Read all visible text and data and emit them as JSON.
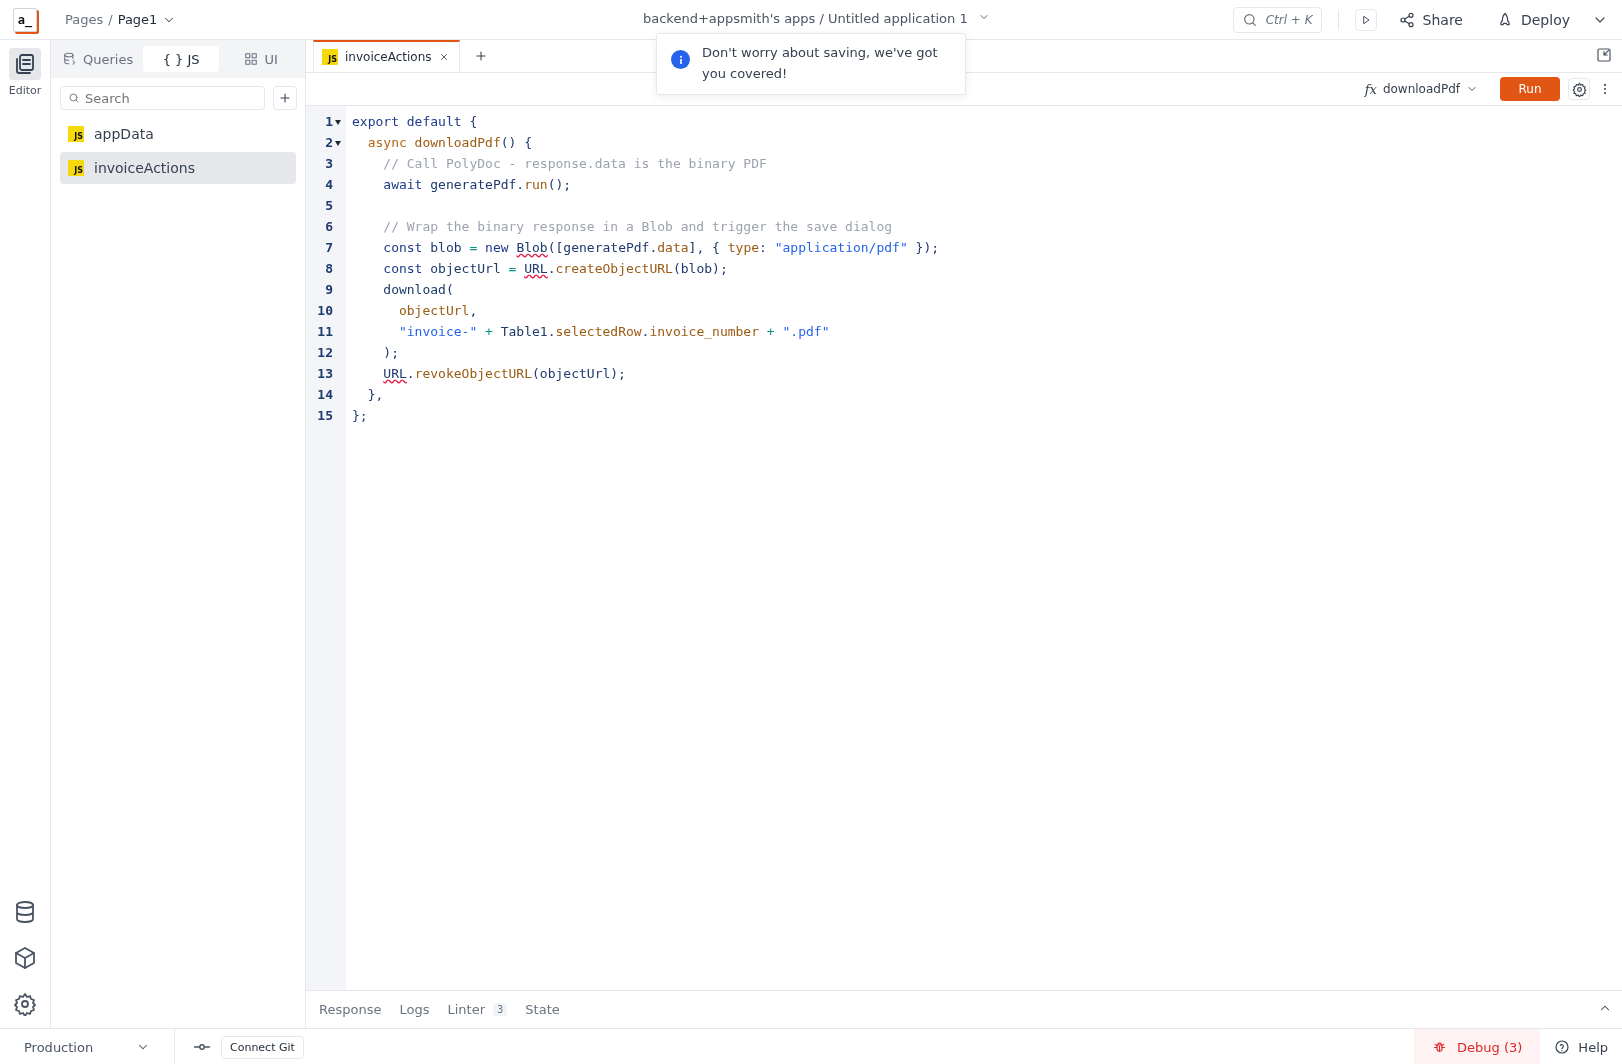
{
  "topbar": {
    "logo": "a_",
    "breadcrumb_root": "Pages",
    "breadcrumb_separator": "/",
    "breadcrumb_page": "Page1",
    "app_title": "backend+appsmith's apps / Untitled application 1",
    "search_shortcut": "Ctrl + K",
    "share": "Share",
    "deploy": "Deploy"
  },
  "rail": {
    "items": [
      {
        "label": "Editor",
        "selected": true
      }
    ]
  },
  "sidebar": {
    "tabs": [
      {
        "label": "Queries",
        "selected": false
      },
      {
        "label": "{ } JS",
        "selected": true
      },
      {
        "label": "UI",
        "selected": false
      }
    ],
    "search": {
      "placeholder": "Search"
    },
    "items": [
      {
        "badge": "JS",
        "label": "appData",
        "selected": false
      },
      {
        "badge": "JS",
        "label": "invoiceActions",
        "selected": true
      }
    ]
  },
  "editor": {
    "tabs": [
      {
        "badge": "JS",
        "label": "invoiceActions",
        "selected": true
      }
    ],
    "function_label": "fx",
    "function": "downloadPdf",
    "run": "Run",
    "lines": [
      {
        "number": "1",
        "fold": true,
        "tokens": [
          {
            "kind": "kw",
            "text": "export default"
          },
          {
            "kind": "p",
            "text": " {"
          }
        ]
      },
      {
        "number": "2",
        "fold": true,
        "tokens": [
          {
            "kind": "mod",
            "text": "  async"
          },
          {
            "kind": "fn",
            "text": " downloadPdf"
          },
          {
            "kind": "p",
            "text": "() {"
          }
        ]
      },
      {
        "number": "3",
        "fold": false,
        "tokens": [
          {
            "kind": "c",
            "text": "    // Call PolyDoc - response.data is the binary PDF"
          }
        ]
      },
      {
        "number": "4",
        "fold": false,
        "tokens": [
          {
            "kind": "kw",
            "text": "    await"
          },
          {
            "kind": "p",
            "text": " generatePdf."
          },
          {
            "kind": "fn",
            "text": "run"
          },
          {
            "kind": "p",
            "text": "();"
          }
        ]
      },
      {
        "number": "5",
        "fold": false
      },
      {
        "number": "6",
        "fold": false,
        "tokens": [
          {
            "kind": "c",
            "text": "    // Wrap the binary response in a Blob and trigger the save dialog"
          }
        ]
      },
      {
        "number": "7",
        "fold": false,
        "tokens": [
          {
            "kind": "kw",
            "text": "    const"
          },
          {
            "kind": "p",
            "text": " blob "
          },
          {
            "kind": "op",
            "text": "="
          },
          {
            "kind": "kw",
            "text": " new "
          },
          {
            "kind": "err",
            "text": "Blob"
          },
          {
            "kind": "p",
            "text": "([generatePdf."
          },
          {
            "kind": "fn",
            "text": "data"
          },
          {
            "kind": "p",
            "text": "], { "
          },
          {
            "kind": "fn",
            "text": "type"
          },
          {
            "kind": "p",
            "text": ": "
          },
          {
            "kind": "s",
            "text": "\"application/pdf\""
          },
          {
            "kind": "p",
            "text": " });"
          }
        ]
      },
      {
        "number": "8",
        "fold": false,
        "tokens": [
          {
            "kind": "kw",
            "text": "    const"
          },
          {
            "kind": "p",
            "text": " objectUrl "
          },
          {
            "kind": "op",
            "text": "= "
          },
          {
            "kind": "err",
            "text": "URL"
          },
          {
            "kind": "p",
            "text": "."
          },
          {
            "kind": "fn",
            "text": "createObjectURL"
          },
          {
            "kind": "p",
            "text": "(blob);"
          }
        ]
      },
      {
        "number": "9",
        "fold": false,
        "tokens": [
          {
            "kind": "p",
            "text": "    download("
          }
        ]
      },
      {
        "number": "10",
        "fold": false,
        "tokens": [
          {
            "kind": "fn",
            "text": "      objectUrl"
          },
          {
            "kind": "p",
            "text": ","
          }
        ]
      },
      {
        "number": "11",
        "fold": false,
        "tokens": [
          {
            "kind": "s",
            "text": "      \"invoice-\""
          },
          {
            "kind": "op",
            "text": " +"
          },
          {
            "kind": "p",
            "text": " Table1."
          },
          {
            "kind": "fn",
            "text": "selectedRow"
          },
          {
            "kind": "p",
            "text": "."
          },
          {
            "kind": "fn",
            "text": "invoice_number"
          },
          {
            "kind": "op",
            "text": " + "
          },
          {
            "kind": "s",
            "text": "\".pdf\""
          }
        ]
      },
      {
        "number": "12",
        "fold": false,
        "tokens": [
          {
            "kind": "p",
            "text": "    );"
          }
        ]
      },
      {
        "number": "13",
        "fold": false,
        "tokens": [
          {
            "kind": "err",
            "text": "    URL"
          },
          {
            "kind": "p",
            "text": "."
          },
          {
            "kind": "fn",
            "text": "revokeObjectURL"
          },
          {
            "kind": "p",
            "text": "(objectUrl);"
          }
        ]
      },
      {
        "number": "14",
        "fold": false,
        "tokens": [
          {
            "kind": "p",
            "text": "  },"
          }
        ]
      },
      {
        "number": "15",
        "fold": false,
        "tokens": [
          {
            "kind": "p",
            "text": "};"
          }
        ]
      }
    ]
  },
  "toast": {
    "message": "Don't worry about saving, we've got you covered!"
  },
  "bottom_panel": {
    "tabs": [
      {
        "label": "Response",
        "selected": false
      },
      {
        "label": "Logs",
        "selected": false
      },
      {
        "label": "Linter",
        "count": "3",
        "selected": false
      },
      {
        "label": "State",
        "selected": false
      }
    ]
  },
  "status_bar": {
    "environment": "Production",
    "connect_git": "Connect Git",
    "debug": "Debug (3)",
    "help": "Help"
  }
}
